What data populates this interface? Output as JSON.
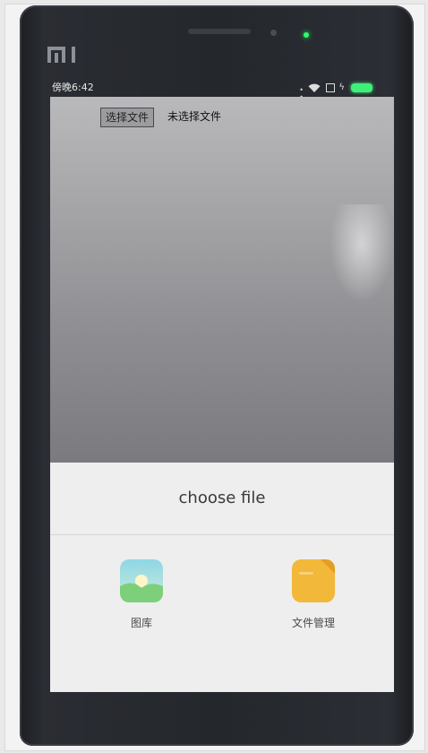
{
  "status_bar": {
    "time": "傍晚6:42",
    "signal_icon": "signal-dots-icon",
    "wifi_icon": "wifi-icon",
    "sim_icon": "sim-icon",
    "charging_icon": "charging-icon",
    "battery_icon": "battery-icon",
    "battery_color": "#3ef07a"
  },
  "device": {
    "brand_logo": "MI",
    "led_color": "#2cff6a"
  },
  "web_page": {
    "file_input": {
      "button_label": "选择文件",
      "status_text": "未选择文件"
    }
  },
  "chooser": {
    "title": "choose file",
    "options": [
      {
        "label": "图库",
        "icon": "gallery-icon",
        "color": "#8fd3c4"
      },
      {
        "label": "文件管理",
        "icon": "folder-icon",
        "color": "#f1b83a"
      }
    ]
  }
}
